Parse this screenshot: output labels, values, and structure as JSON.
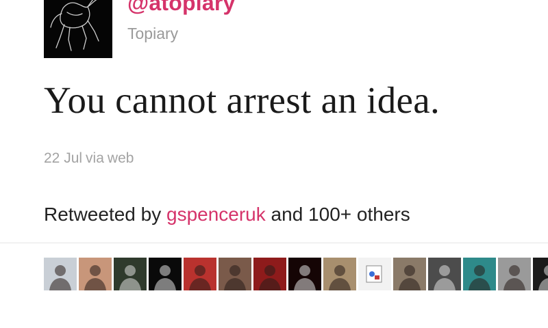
{
  "tweet": {
    "handle": "@atopiary",
    "display_name": "Topiary",
    "text": "You cannot arrest an idea.",
    "date": "22 Jul",
    "via_prefix": "via",
    "source": "web"
  },
  "retweets": {
    "prefix": "Retweeted by",
    "user": "gspenceruk",
    "suffix": "and 100+ others",
    "avatars": [
      {
        "name": "retweeter-avatar-1",
        "bg": "#c9cfd6"
      },
      {
        "name": "retweeter-avatar-2",
        "bg": "#c8967a"
      },
      {
        "name": "retweeter-avatar-3",
        "bg": "#2f3a2c"
      },
      {
        "name": "retweeter-avatar-4",
        "bg": "#0a0a0a"
      },
      {
        "name": "retweeter-avatar-5",
        "bg": "#b9322e"
      },
      {
        "name": "retweeter-avatar-6",
        "bg": "#7a5a4a"
      },
      {
        "name": "retweeter-avatar-7",
        "bg": "#8e1b1b"
      },
      {
        "name": "retweeter-avatar-8",
        "bg": "#150505"
      },
      {
        "name": "retweeter-avatar-9",
        "bg": "#a88f6e"
      },
      {
        "name": "retweeter-avatar-10",
        "bg": "#f2f2f2"
      },
      {
        "name": "retweeter-avatar-11",
        "bg": "#8a7a68"
      },
      {
        "name": "retweeter-avatar-12",
        "bg": "#4c4c4c"
      },
      {
        "name": "retweeter-avatar-13",
        "bg": "#2e8a8a"
      },
      {
        "name": "retweeter-avatar-14",
        "bg": "#9a9a9a"
      },
      {
        "name": "retweeter-avatar-15",
        "bg": "#1a1a1a"
      }
    ]
  },
  "colors": {
    "link": "#d5336a",
    "muted": "#a3a3a3",
    "text": "#1a1a1a"
  }
}
